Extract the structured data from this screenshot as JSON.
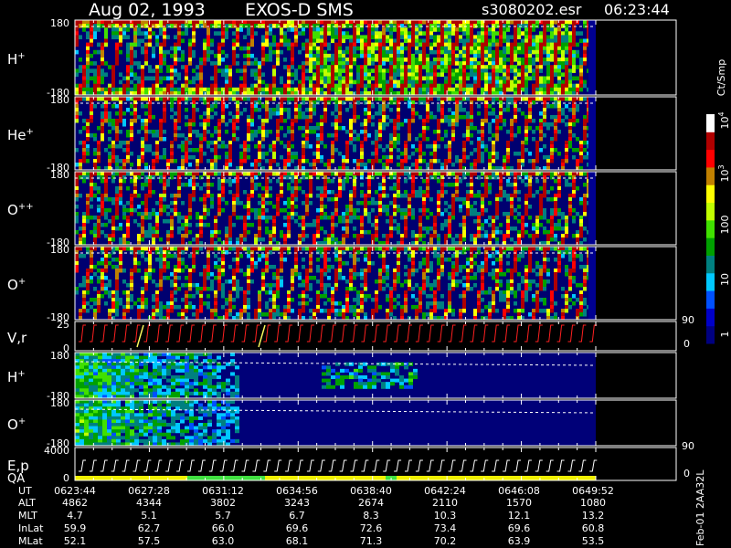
{
  "header": {
    "date": "Aug 02, 1993",
    "instrument": "EXOS-D SMS",
    "filename": "s3080202.esr",
    "time": "06:23:44"
  },
  "colorbar": {
    "unit_label": "Ct/Smp",
    "ticks": [
      "1",
      "10",
      "100",
      "10",
      "10"
    ],
    "tick_exponents": [
      "",
      "",
      "",
      "3",
      "4"
    ]
  },
  "panels": [
    {
      "label": "H",
      "sup": "+",
      "ytop": "180",
      "ybot": "-180",
      "type": "spin"
    },
    {
      "label": "He",
      "sup": "+",
      "ytop": "180",
      "ybot": "-180",
      "type": "spin"
    },
    {
      "label": "O",
      "sup": "++",
      "ytop": "180",
      "ybot": "-180",
      "type": "spin"
    },
    {
      "label": "O",
      "sup": "+",
      "ytop": "180",
      "ybot": "-180",
      "type": "spin"
    },
    {
      "label": "V,r",
      "sup": "",
      "ytop": "25",
      "ybot": "0",
      "rtop": "90",
      "rbot": "0",
      "type": "line"
    },
    {
      "label": "H",
      "sup": "+",
      "ytop": "180",
      "ybot": "-180",
      "type": "pitch"
    },
    {
      "label": "O",
      "sup": "+",
      "ytop": "180",
      "ybot": "-180",
      "type": "pitch"
    },
    {
      "label": "E,p",
      "label2": "QA",
      "sup": "",
      "ytop": "4000",
      "ybot": "0",
      "rtop": "90",
      "rbot": "0",
      "type": "line"
    }
  ],
  "colors": {
    "spectrum": [
      "#000080",
      "#0000c8",
      "#0050ff",
      "#00c8ff",
      "#008080",
      "#00a000",
      "#40e000",
      "#c0ff00",
      "#ffff00",
      "#c08000",
      "#ff0000",
      "#b00000",
      "#ffffff"
    ],
    "trace": "#ff2020",
    "marker": "#ffff60",
    "qa_base": "#f0f000",
    "qa_good": "#40e040"
  },
  "footer": {
    "row_labels": [
      "UT",
      "ALT",
      "MLT",
      "InLat",
      "MLat"
    ],
    "columns": [
      [
        "0623:44",
        "4862",
        "4.7",
        "59.9",
        "52.1"
      ],
      [
        "0627:28",
        "4344",
        "5.1",
        "62.7",
        "57.5"
      ],
      [
        "0631:12",
        "3802",
        "5.7",
        "66.0",
        "63.0"
      ],
      [
        "0634:56",
        "3243",
        "6.7",
        "69.6",
        "68.1"
      ],
      [
        "0638:40",
        "2674",
        "8.3",
        "72.6",
        "71.3"
      ],
      [
        "0642:24",
        "2110",
        "10.3",
        "73.4",
        "70.2"
      ],
      [
        "0646:08",
        "1570",
        "12.1",
        "69.6",
        "63.9"
      ],
      [
        "0649:52",
        "1080",
        "13.2",
        "60.8",
        "53.5"
      ]
    ],
    "side_note": "Feb-01 2AA32L"
  },
  "chart_data": {
    "type": "heatmap",
    "title": "Aug 02, 1993   EXOS-D SMS",
    "x_ticks": [
      "0623:44",
      "0627:28",
      "0631:12",
      "0634:56",
      "0638:40",
      "0642:24",
      "0646:08",
      "0649:52"
    ],
    "colorbar_scale": "log",
    "colorbar_range": [
      1,
      10000
    ],
    "series": [
      {
        "name": "H+",
        "ylim": [
          -180,
          180
        ]
      },
      {
        "name": "He+",
        "ylim": [
          -180,
          180
        ]
      },
      {
        "name": "O++",
        "ylim": [
          -180,
          180
        ]
      },
      {
        "name": "O+",
        "ylim": [
          -180,
          180
        ]
      },
      {
        "name": "V,r",
        "ylim": [
          0,
          25
        ],
        "right_ylim": [
          0,
          90
        ]
      },
      {
        "name": "H+",
        "ylim": [
          -180,
          180
        ]
      },
      {
        "name": "O+",
        "ylim": [
          -180,
          180
        ]
      },
      {
        "name": "E,p",
        "ylim": [
          0,
          4000
        ],
        "right_ylim": [
          0,
          90
        ]
      }
    ]
  }
}
